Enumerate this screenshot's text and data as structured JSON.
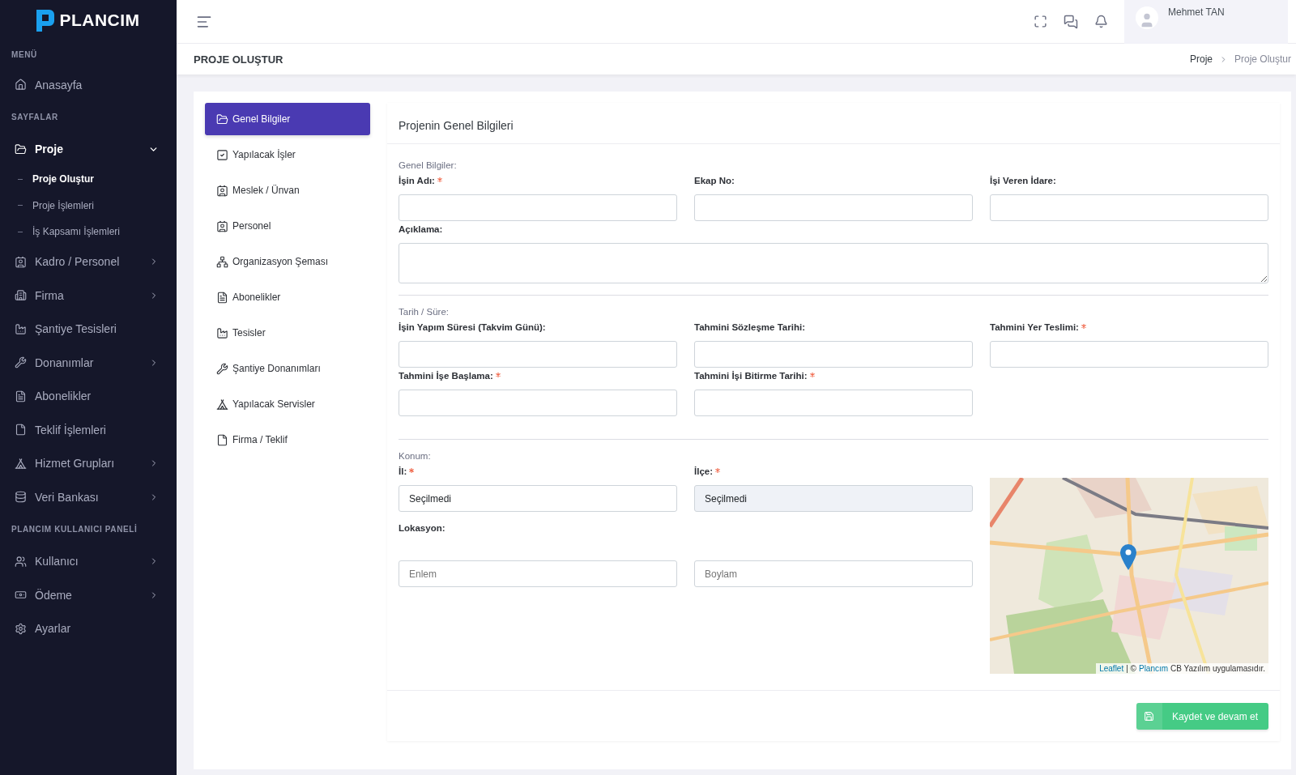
{
  "brand": {
    "name": "PLANCIM"
  },
  "topbar": {
    "user": "Mehmet TAN"
  },
  "sidebar": {
    "sections": [
      {
        "heading": "MENÜ",
        "items": [
          {
            "label": "Anasayfa",
            "selected": false
          }
        ]
      },
      {
        "heading": "SAYFALAR",
        "items": [
          {
            "label": "Proje",
            "selected": true,
            "expanded": true,
            "children": [
              {
                "label": "Proje Oluştur",
                "selected": true
              },
              {
                "label": "Proje İşlemleri",
                "selected": false
              },
              {
                "label": "İş Kapsamı İşlemleri",
                "selected": false
              }
            ]
          },
          {
            "label": "Kadro / Personel",
            "selected": false,
            "expanded": false
          },
          {
            "label": "Firma",
            "selected": false,
            "expanded": false
          },
          {
            "label": "Şantiye Tesisleri",
            "selected": false
          },
          {
            "label": "Donanımlar",
            "selected": false,
            "expanded": false
          },
          {
            "label": "Abonelikler",
            "selected": false
          },
          {
            "label": "Teklif İşlemleri",
            "selected": false
          },
          {
            "label": "Hizmet Grupları",
            "selected": false,
            "expanded": false
          },
          {
            "label": "Veri Bankası",
            "selected": false,
            "expanded": false
          }
        ]
      },
      {
        "heading": "PLANCIM KULLANICI PANELİ",
        "items": [
          {
            "label": "Kullanıcı",
            "selected": false,
            "expanded": false
          },
          {
            "label": "Ödeme",
            "selected": false,
            "expanded": false
          },
          {
            "label": "Ayarlar",
            "selected": false
          }
        ]
      }
    ]
  },
  "page_title": "PROJE OLUŞTUR",
  "breadcrumb": [
    {
      "label": "Proje",
      "selected": false
    },
    {
      "label": "Proje Oluştur",
      "selected": true
    }
  ],
  "steps": [
    {
      "label": "Genel Bilgiler",
      "selected": true
    },
    {
      "label": "Yapılacak İşler",
      "selected": false
    },
    {
      "label": "Meslek / Ünvan",
      "selected": false
    },
    {
      "label": "Personel",
      "selected": false
    },
    {
      "label": "Organizasyon Şeması",
      "selected": false
    },
    {
      "label": "Abonelikler",
      "selected": false
    },
    {
      "label": "Tesisler",
      "selected": false
    },
    {
      "label": "Şantiye Donanımları",
      "selected": false
    },
    {
      "label": "Yapılacak Servisler",
      "selected": false
    },
    {
      "label": "Firma / Teklif",
      "selected": false
    }
  ],
  "form": {
    "title": "Projenin Genel Bilgileri",
    "sections": [
      {
        "title": "Genel Bilgiler:",
        "fields": [
          {
            "kind": "text",
            "label": "İşin Adı:",
            "required": true
          },
          {
            "kind": "text",
            "label": "Ekap No:",
            "required": false
          },
          {
            "kind": "text",
            "label": "İşi Veren İdare:",
            "required": false
          },
          {
            "kind": "textarea",
            "label": "Açıklama:",
            "required": false
          }
        ]
      },
      {
        "title": "Tarih / Süre:",
        "fields": [
          {
            "kind": "text",
            "label": "İşin Yapım Süresi (Takvim Günü):",
            "required": false
          },
          {
            "kind": "text",
            "label": "Tahmini Sözleşme Tarihi:",
            "required": false
          },
          {
            "kind": "text",
            "label": "Tahmini Yer Teslimi:",
            "required": true
          },
          {
            "kind": "text",
            "label": "Tahmini İşe Başlama:",
            "required": true
          },
          {
            "kind": "text",
            "label": "Tahmini İşi Bitirme Tarihi:",
            "required": true
          }
        ]
      }
    ],
    "location": {
      "title": "Konum:",
      "province": {
        "label": "İl:",
        "required": true,
        "value": "Seçilmedi",
        "disabled": false
      },
      "district": {
        "label": "İlçe:",
        "required": true,
        "value": "Seçilmedi",
        "disabled": true
      },
      "coords_label": "Lokasyon:",
      "latitude": {
        "placeholder": "Enlem"
      },
      "longitude": {
        "placeholder": "Boylam"
      },
      "map": {
        "kind": "picture",
        "attribution": {
          "leaflet": "Leaflet",
          "separator": "| ©",
          "owner": "Plancım",
          "rest": "CB Yazılım uygulamasıdır."
        }
      }
    },
    "submit": "Kaydet ve devam et"
  }
}
